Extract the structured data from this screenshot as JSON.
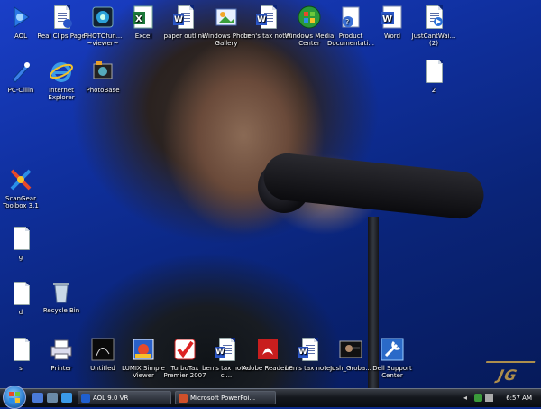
{
  "desktop": {
    "icons": [
      {
        "name": "aol-icon",
        "label": "AOL"
      },
      {
        "name": "real-clips-page-icon",
        "label": "Real Clips Page"
      },
      {
        "name": "photofunia-viewer-icon",
        "label": "PHOTOfun... ~viewer~"
      },
      {
        "name": "excel-icon",
        "label": "Excel"
      },
      {
        "name": "paper-outline-icon",
        "label": "paper outline"
      },
      {
        "name": "windows-photo-gallery-icon",
        "label": "Windows Photo Gallery"
      },
      {
        "name": "bens-tax-notes-icon",
        "label": "ben's tax notes"
      },
      {
        "name": "windows-media-center-icon",
        "label": "Windows Media Center"
      },
      {
        "name": "product-documentation-icon",
        "label": "Product Documentati..."
      },
      {
        "name": "word-icon",
        "label": "Word"
      },
      {
        "name": "justcantwait-icon",
        "label": "JustCantWai... (2)"
      },
      {
        "name": "pc-cillin-icon",
        "label": "PC-Cillin"
      },
      {
        "name": "internet-explorer-icon",
        "label": "Internet Explorer"
      },
      {
        "name": "photobase-icon",
        "label": "PhotoBase"
      },
      {
        "name": "file-2-icon",
        "label": "2"
      },
      {
        "name": "scangear-toolbox-icon",
        "label": "ScanGear Toolbox 3.1"
      },
      {
        "name": "file-g-icon",
        "label": "g"
      },
      {
        "name": "file-d-icon",
        "label": "d"
      },
      {
        "name": "recycle-bin-icon",
        "label": "Recycle Bin"
      },
      {
        "name": "file-blank-icon",
        "label": "s"
      },
      {
        "name": "printer-icon",
        "label": "Printer"
      },
      {
        "name": "untitled-icon",
        "label": "Untitled"
      },
      {
        "name": "lumix-simple-viewer-icon",
        "label": "LUMIX Simple Viewer"
      },
      {
        "name": "turbotax-premier-icon",
        "label": "TurboTax Premier 2007"
      },
      {
        "name": "bens-tax-notes-cl-icon",
        "label": "ben's tax notes cl..."
      },
      {
        "name": "adobe-reader-icon",
        "label": "Adobe Reader 8"
      },
      {
        "name": "bens-tax-notes-2-icon",
        "label": "ben's tax notes"
      },
      {
        "name": "josh-groban-icon",
        "label": "Josh_Groba..."
      },
      {
        "name": "dell-support-center-icon",
        "label": "Dell Support Center"
      }
    ]
  },
  "taskbar": {
    "tasks": [
      {
        "label": "AOL 9.0 VR",
        "icon_color": "#1f5fd0"
      },
      {
        "label": "Microsoft PowerPoi...",
        "icon_color": "#d0502a"
      }
    ],
    "clock": "6:57 AM"
  },
  "colors": {
    "accent": "#1a3fc8",
    "taskbar": "#15181e"
  }
}
